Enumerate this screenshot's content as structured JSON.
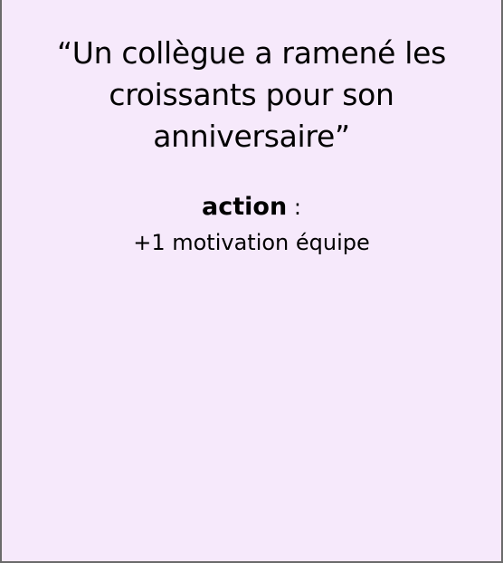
{
  "card": {
    "quote": "“Un collègue a ramené les croissants pour son anniversaire”",
    "action_label": "action",
    "action_separator": " :",
    "effect": "+1 motivation équipe",
    "background_color": "#f6e9fb",
    "border_color": "#6b6b6b"
  }
}
